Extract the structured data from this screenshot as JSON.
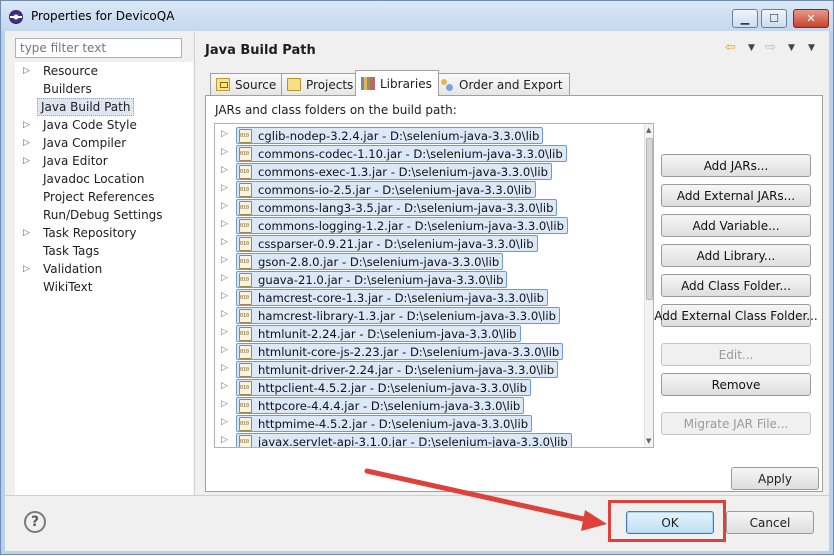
{
  "window": {
    "title": "Properties for DevicoQA"
  },
  "filter": {
    "placeholder": "type filter text"
  },
  "nav": {
    "items": [
      {
        "label": "Resource",
        "expandable": true
      },
      {
        "label": "Builders",
        "expandable": false
      },
      {
        "label": "Java Build Path",
        "expandable": false,
        "selected": true
      },
      {
        "label": "Java Code Style",
        "expandable": true
      },
      {
        "label": "Java Compiler",
        "expandable": true
      },
      {
        "label": "Java Editor",
        "expandable": true
      },
      {
        "label": "Javadoc Location",
        "expandable": false
      },
      {
        "label": "Project References",
        "expandable": false
      },
      {
        "label": "Run/Debug Settings",
        "expandable": false
      },
      {
        "label": "Task Repository",
        "expandable": true
      },
      {
        "label": "Task Tags",
        "expandable": false
      },
      {
        "label": "Validation",
        "expandable": true
      },
      {
        "label": "WikiText",
        "expandable": false
      }
    ]
  },
  "page": {
    "title": "Java Build Path"
  },
  "tabs": [
    {
      "label": "Source",
      "icon": "source-folder-icon"
    },
    {
      "label": "Projects",
      "icon": "project-icon"
    },
    {
      "label": "Libraries",
      "icon": "library-icon",
      "active": true
    },
    {
      "label": "Order and Export",
      "icon": "order-export-icon"
    }
  ],
  "libraries": {
    "heading": "JARs and class folders on the build path:",
    "jars": [
      "cglib-nodep-3.2.4.jar - D:\\selenium-java-3.3.0\\lib",
      "commons-codec-1.10.jar - D:\\selenium-java-3.3.0\\lib",
      "commons-exec-1.3.jar - D:\\selenium-java-3.3.0\\lib",
      "commons-io-2.5.jar - D:\\selenium-java-3.3.0\\lib",
      "commons-lang3-3.5.jar - D:\\selenium-java-3.3.0\\lib",
      "commons-logging-1.2.jar - D:\\selenium-java-3.3.0\\lib",
      "cssparser-0.9.21.jar - D:\\selenium-java-3.3.0\\lib",
      "gson-2.8.0.jar - D:\\selenium-java-3.3.0\\lib",
      "guava-21.0.jar - D:\\selenium-java-3.3.0\\lib",
      "hamcrest-core-1.3.jar - D:\\selenium-java-3.3.0\\lib",
      "hamcrest-library-1.3.jar - D:\\selenium-java-3.3.0\\lib",
      "htmlunit-2.24.jar - D:\\selenium-java-3.3.0\\lib",
      "htmlunit-core-js-2.23.jar - D:\\selenium-java-3.3.0\\lib",
      "htmlunit-driver-2.24.jar - D:\\selenium-java-3.3.0\\lib",
      "httpclient-4.5.2.jar - D:\\selenium-java-3.3.0\\lib",
      "httpcore-4.4.4.jar - D:\\selenium-java-3.3.0\\lib",
      "httpmime-4.5.2.jar - D:\\selenium-java-3.3.0\\lib",
      "javax.servlet-api-3.1.0.jar - D:\\selenium-java-3.3.0\\lib"
    ],
    "buttons": {
      "add_jars": "Add JARs...",
      "add_external_jars": "Add External JARs...",
      "add_variable": "Add Variable...",
      "add_library": "Add Library...",
      "add_class_folder": "Add Class Folder...",
      "add_external_class_folder": "Add External Class Folder...",
      "edit": "Edit...",
      "remove": "Remove",
      "migrate_jar": "Migrate JAR File..."
    }
  },
  "footer": {
    "apply": "Apply",
    "ok": "OK",
    "cancel": "Cancel",
    "help": "?"
  },
  "colors": {
    "annotation": "#e0403a",
    "selection": "#dbe8f8"
  }
}
